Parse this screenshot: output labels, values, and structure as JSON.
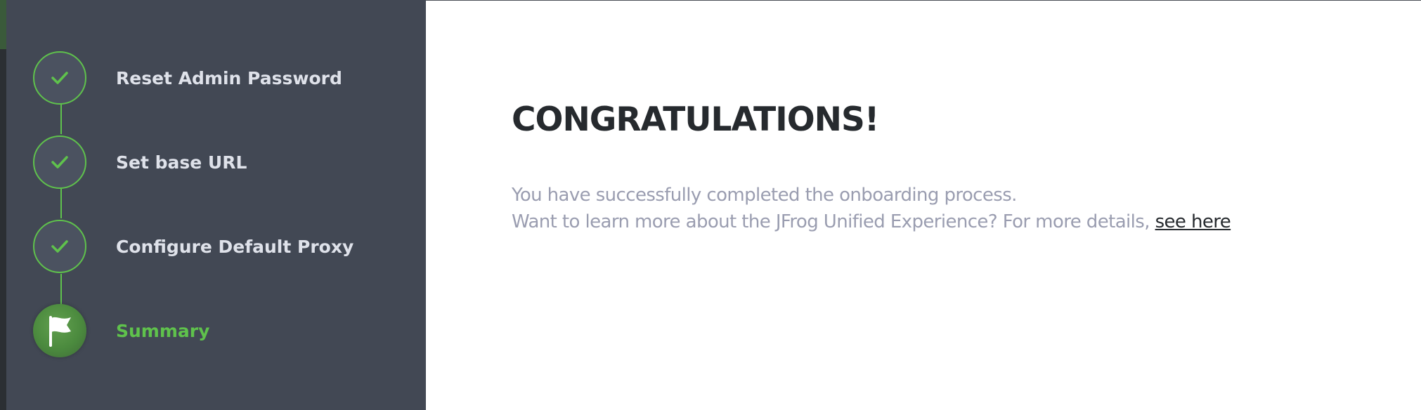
{
  "sidebar": {
    "steps": [
      {
        "label": "Reset Admin Password",
        "status": "completed",
        "icon": "checkmark-icon"
      },
      {
        "label": "Set base URL",
        "status": "completed",
        "icon": "checkmark-icon"
      },
      {
        "label": "Configure Default Proxy",
        "status": "completed",
        "icon": "checkmark-icon"
      },
      {
        "label": "Summary",
        "status": "active",
        "icon": "flag-icon"
      }
    ]
  },
  "main": {
    "title": "CONGRATULATIONS!",
    "line1": "You have successfully completed the onboarding process.",
    "line2_prefix": "Want to learn more about the JFrog Unified Experience? For more details, ",
    "link_text": "see here"
  },
  "colors": {
    "sidebar_bg": "#424854",
    "accent_green": "#5fc24c",
    "step_text": "#dfe2ea",
    "title_text": "#262a2e",
    "body_text": "#9a9db0"
  }
}
